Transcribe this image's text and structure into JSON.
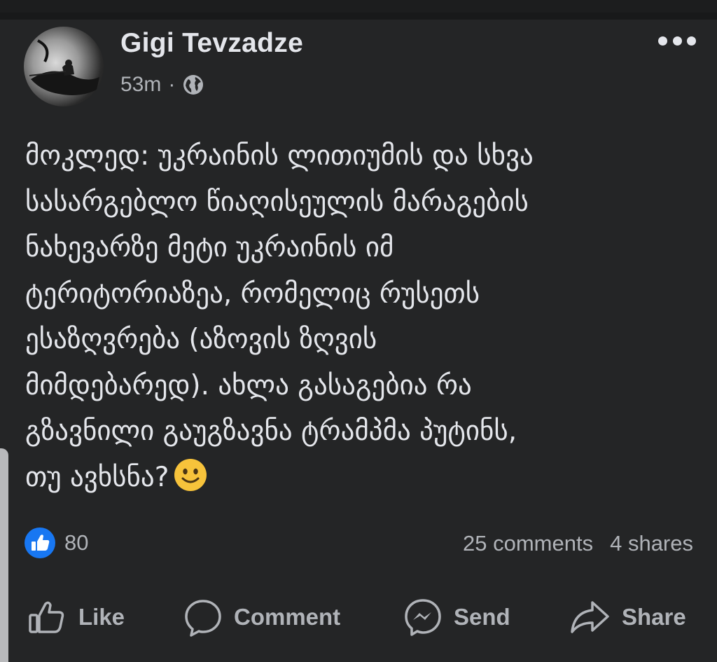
{
  "post": {
    "author": "Gigi Tevzadze",
    "time": "53m",
    "separator": "·",
    "privacy_icon": "globe-icon",
    "more_icon": "more-options-icon",
    "text": "მოკლედ: უკრაინის ლითიუმის და სხვა\nსასარგებლო წიაღისეულის მარაგების\nნახევარზე მეტი უკრაინის იმ\nტერიტორიაზეა, რომელიც რუსეთს\nესაზღვრება (აზოვის ზღვის\nმიმდებარედ). ახლა გასაგებია რა\nგზავნილი გაუგზავნა ტრამპმა პუტინს,\nთუ ავხსნა?",
    "emoji": "slightly-smiling-face",
    "reaction_count": "80",
    "comments": "25 comments",
    "shares": "4 shares"
  },
  "actions": {
    "like": "Like",
    "comment": "Comment",
    "send": "Send",
    "share": "Share"
  },
  "colors": {
    "background": "#242526",
    "text": "#e4e6eb",
    "secondary_text": "#b0b3b8",
    "like_blue": "#1877f2",
    "emoji_yellow": "#f7c33b"
  }
}
